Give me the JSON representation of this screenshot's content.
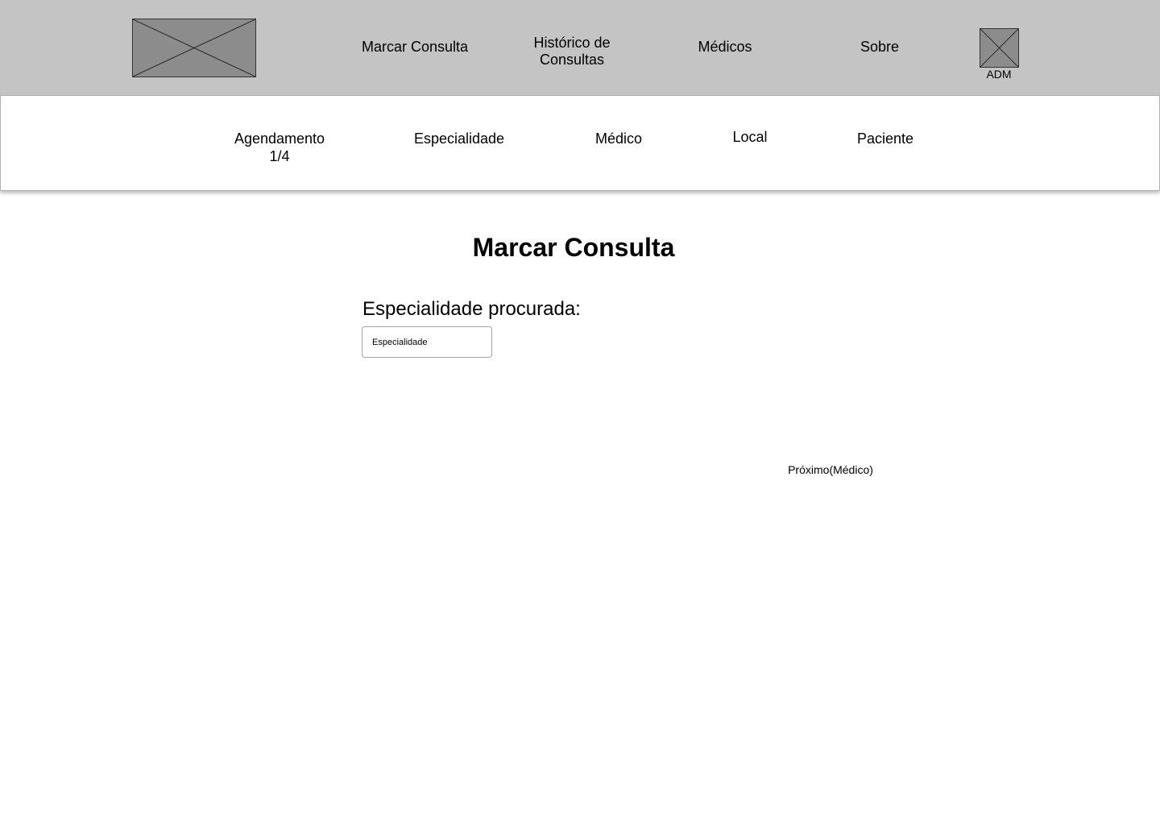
{
  "header": {
    "nav": {
      "marcar_consulta": "Marcar Consulta",
      "historico": "Histórico de Consultas",
      "medicos": "Médicos",
      "sobre": "Sobre"
    },
    "user_label": "ADM",
    "logo_icon": "image-placeholder-icon",
    "avatar_icon": "image-placeholder-icon"
  },
  "steps": {
    "agendamento": "Agendamento 1/4",
    "especialidade": "Especialidade",
    "medico": "Médico",
    "local": "Local",
    "paciente": "Paciente"
  },
  "main": {
    "title": "Marcar Consulta",
    "specialty_label": "Especialidade procurada:",
    "specialty_input": {
      "value": "",
      "placeholder": "Especialidade"
    },
    "next_label": "Próximo(Médico)"
  },
  "colors": {
    "topbar_bg": "#c4c4c4",
    "placeholder_fill": "#8c8c8c"
  }
}
